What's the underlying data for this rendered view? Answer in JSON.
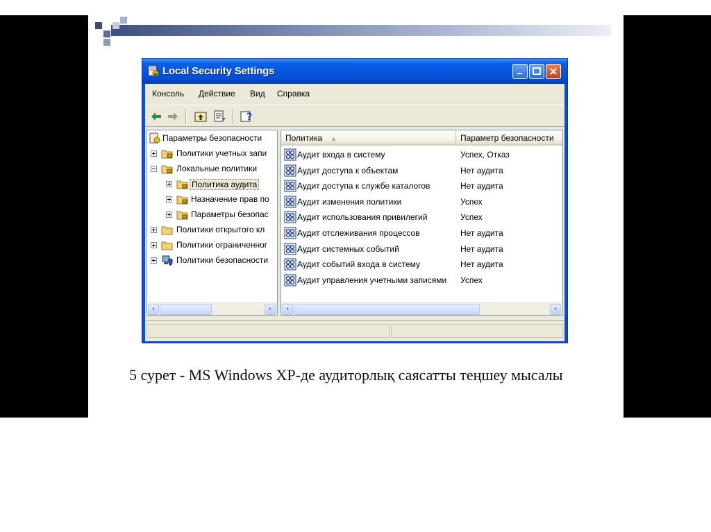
{
  "window": {
    "title": "Local Security Settings"
  },
  "menu": [
    "Консоль",
    "Действие",
    "Вид",
    "Справка"
  ],
  "toolbar": {
    "buttons": [
      "back-arrow-icon",
      "forward-arrow-icon",
      "up-folder-icon",
      "export-list-icon",
      "help-icon"
    ]
  },
  "tree": {
    "root": "Параметры безопасности",
    "items": [
      {
        "label": "Политики учетных запи",
        "expander": "plus"
      },
      {
        "label": "Локальные политики",
        "expander": "minus"
      },
      {
        "label": "Политика аудита",
        "expander": "plus",
        "selected": true
      },
      {
        "label": "Назначение прав по",
        "expander": "plus"
      },
      {
        "label": "Параметры безопас",
        "expander": "plus"
      },
      {
        "label": "Политики открытого кл",
        "expander": "plus"
      },
      {
        "label": "Политики ограниченног",
        "expander": "plus"
      },
      {
        "label": "Политики безопасности",
        "expander": "plus"
      }
    ]
  },
  "list": {
    "columns": [
      "Политика",
      "Параметр безопасности"
    ],
    "rows": [
      {
        "policy": "Аудит входа в систему",
        "value": "Успех, Отказ"
      },
      {
        "policy": "Аудит доступа к объектам",
        "value": "Нет аудита"
      },
      {
        "policy": "Аудит доступа к службе каталогов",
        "value": "Нет аудита"
      },
      {
        "policy": "Аудит изменения политики",
        "value": "Успех"
      },
      {
        "policy": "Аудит использования привилегий",
        "value": "Успех"
      },
      {
        "policy": "Аудит отслеживания процессов",
        "value": "Нет аудита"
      },
      {
        "policy": "Аудит системных событий",
        "value": "Нет аудита"
      },
      {
        "policy": "Аудит событий входа в систему",
        "value": "Нет аудита"
      },
      {
        "policy": "Аудит управления учетными записями",
        "value": "Успех"
      }
    ]
  },
  "caption": "5 сурет -  MS Windows XP-де аудиторлық саясатты теңшеу мысалы",
  "colors": {
    "titlebar": "#0550d8",
    "window_face": "#ece9d8",
    "slide_bg": "#ffffff",
    "letterbox": "#000000"
  }
}
